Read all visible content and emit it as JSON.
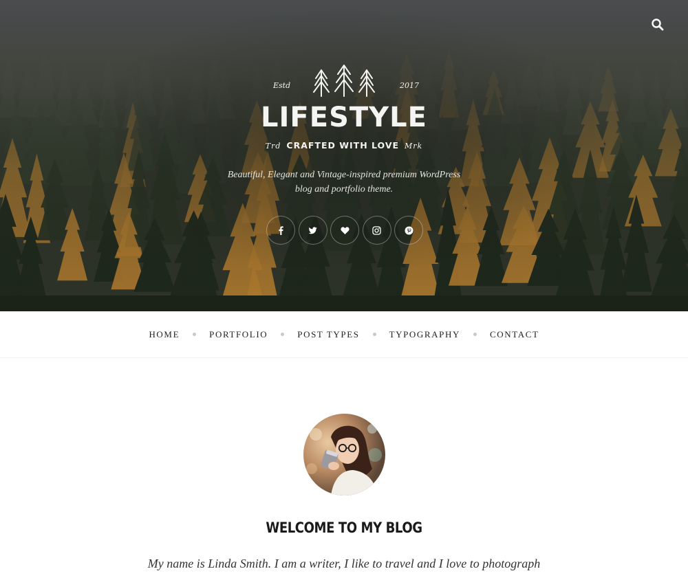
{
  "header": {
    "search_icon": "search-icon",
    "logo": {
      "estd": "Estd",
      "year": "2017",
      "title": "LIFESTYLE",
      "sub_left": "Trd",
      "sub_center": "CRAFTED WITH LOVE",
      "sub_right": "Mrk"
    },
    "tagline_line1": "Beautiful, Elegant and Vintage-inspired premium WordPress",
    "tagline_line2": "blog and portfolio theme.",
    "socials": [
      "facebook-icon",
      "twitter-icon",
      "heart-icon",
      "instagram-icon",
      "pinterest-icon"
    ]
  },
  "nav": {
    "items": [
      {
        "label": "HOME"
      },
      {
        "label": "PORTFOLIO"
      },
      {
        "label": "POST TYPES"
      },
      {
        "label": "TYPOGRAPHY"
      },
      {
        "label": "CONTACT"
      }
    ]
  },
  "main": {
    "heading": "WELCOME TO MY BLOG",
    "intro": "My name is Linda Smith. I am a writer, I like to travel and I love to photograph"
  },
  "colors": {
    "hero_dark": "#2b2f27",
    "foliage_gold": "#b07a2e",
    "nav_text": "#222222",
    "dot": "#c8c8c8"
  }
}
